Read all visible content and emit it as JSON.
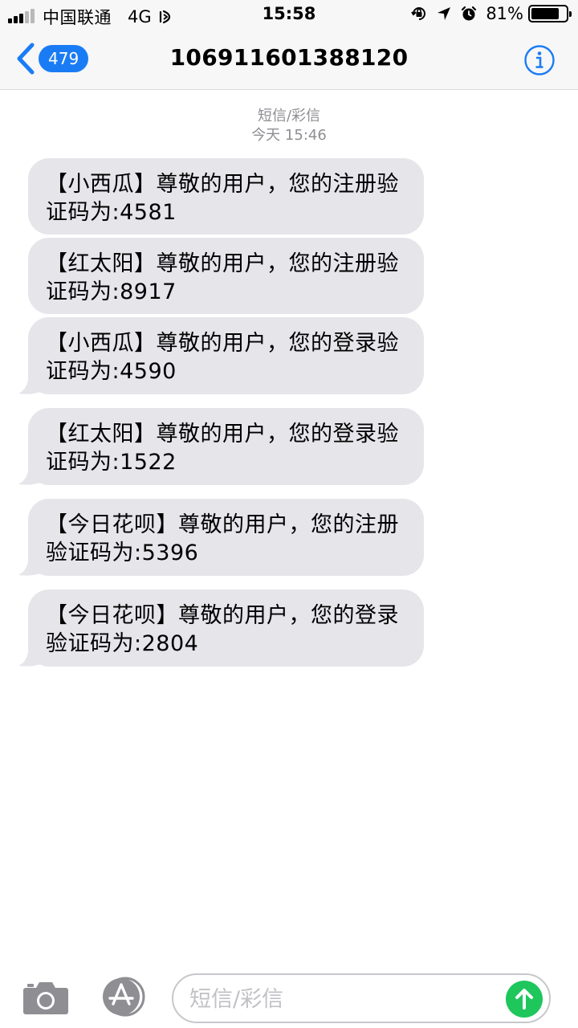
{
  "status": {
    "carrier": "中国联通",
    "network": "4G",
    "time": "15:58",
    "battery_percent": "81%",
    "battery_level": 0.81
  },
  "nav": {
    "back_count": "479",
    "title": "106911601388120"
  },
  "thread": {
    "service": "短信/彩信",
    "timestamp": "今天 15:46"
  },
  "messages": [
    {
      "text": "【小西瓜】尊敬的用户，您的注册验证码为:4581"
    },
    {
      "text": "【红太阳】尊敬的用户，您的注册验证码为:8917"
    },
    {
      "text": "【小西瓜】尊敬的用户，您的登录验证码为:4590"
    },
    {
      "text": "【红太阳】尊敬的用户，您的登录验证码为:1522"
    },
    {
      "text": "【今日花呗】尊敬的用户，您的注册验证码为:5396"
    },
    {
      "text": "【今日花呗】尊敬的用户，您的登录验证码为:2804"
    }
  ],
  "input": {
    "placeholder": "短信/彩信",
    "value": ""
  },
  "colors": {
    "accent": "#1a7cf5",
    "bubble": "#e5e5ea",
    "send": "#1ec65c"
  },
  "icons": [
    "signal-icon",
    "call-forward-icon",
    "rotation-lock-icon",
    "location-arrow-icon",
    "alarm-icon",
    "battery-icon",
    "chevron-left-icon",
    "info-icon",
    "camera-icon",
    "app-store-icon",
    "send-arrow-icon"
  ]
}
